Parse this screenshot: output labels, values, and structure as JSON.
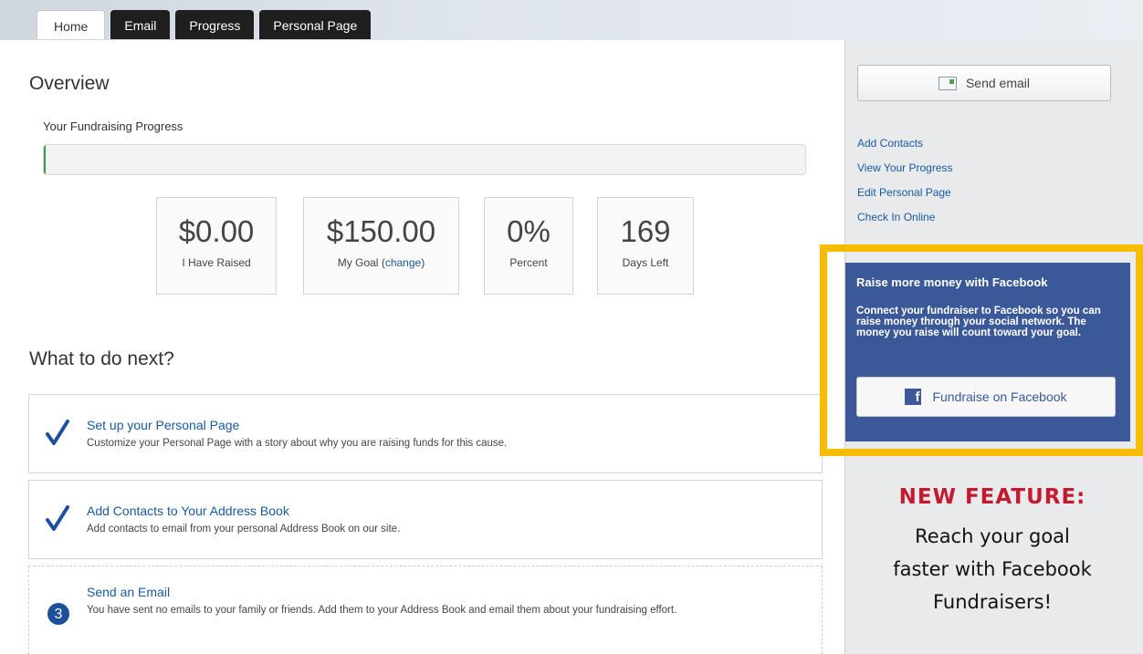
{
  "tabs": [
    "Home",
    "Email",
    "Progress",
    "Personal Page"
  ],
  "overview": {
    "title": "Overview",
    "progress_label": "Your Fundraising Progress",
    "progress_fraction": 0.0
  },
  "stats": {
    "raised": {
      "value": "$0.00",
      "label": "I Have Raised"
    },
    "goal": {
      "value": "$150.00",
      "label": "My Goal",
      "change_link": "change"
    },
    "percent": {
      "value": "0%",
      "label": "Percent"
    },
    "days": {
      "value": "169",
      "label": "Days Left"
    }
  },
  "next": {
    "title": "What to do next?",
    "steps": [
      {
        "title": "Set up your Personal Page",
        "desc": "Customize your Personal Page with a story about why you are raising funds for this cause.",
        "status": "done"
      },
      {
        "title": "Add Contacts to Your Address Book",
        "desc": "Add contacts to email from your personal Address Book on our site.",
        "status": "done"
      },
      {
        "title": "Send an Email",
        "desc": "You have sent no emails to your family or friends. Add them to your Address Book and email them about your fundraising effort.",
        "status": "todo",
        "number": "3"
      }
    ]
  },
  "sidebar": {
    "send_email": "Send email",
    "links": [
      "Add Contacts",
      "View Your Progress",
      "Edit Personal Page",
      "Check In Online"
    ],
    "facebook": {
      "title": "Raise more money with Facebook",
      "text": "Connect your fundraiser to Facebook so you can raise money through your social network. The money you raise will count toward your goal.",
      "button": "Fundraise on Facebook"
    }
  },
  "promo": {
    "headline": "NEW FEATURE:",
    "line1": "Reach your goal",
    "line2": "faster with Facebook",
    "line3": "Fundraisers!"
  },
  "colors": {
    "link": "#1a5aa0",
    "facebook": "#3b5998",
    "highlight": "#f5bc00",
    "promo_red": "#c41a2f",
    "progress_green": "#2e9e3e"
  }
}
